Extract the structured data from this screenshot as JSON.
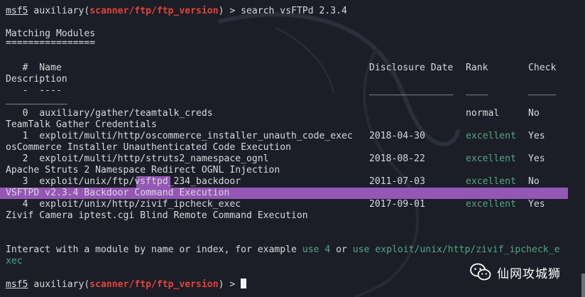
{
  "prompt": {
    "user": "msf5",
    "module_prefix": " auxiliary(",
    "module": "scanner/ftp/ftp_version",
    "module_suffix": ") > "
  },
  "command": "search vsFTPd 2.3.4",
  "heading": "Matching Modules",
  "heading_rule": "================",
  "columns": {
    "num": "   #  Name",
    "date": "Disclosure Date",
    "rank": "Rank",
    "check": "Check",
    "description": "Description"
  },
  "column_rules": {
    "num": "   -  ----",
    "date": "_______________",
    "rank": "____",
    "check": "_____",
    "description": "___________"
  },
  "modules": [
    {
      "index": "   0  ",
      "name": "auxiliary/gather/teamtalk_creds",
      "date": "",
      "rank": "normal",
      "check": "No",
      "description": "TeamTalk Gather Credentials"
    },
    {
      "index": "   1  ",
      "name": "exploit/multi/http/oscommerce_installer_unauth_code_exec",
      "date": "2018-04-30",
      "rank": "excellent",
      "check": "Yes",
      "description": "osCommerce Installer Unauthenticated Code Execution"
    },
    {
      "index": "   2  ",
      "name": "exploit/multi/http/struts2_namespace_ognl",
      "date": "2018-08-22",
      "rank": "excellent",
      "check": "Yes",
      "description": "Apache Struts 2 Namespace Redirect OGNL Injection"
    },
    {
      "index": "   3  ",
      "name_before": "exploit/unix/ftp/",
      "name_match": "vsftpd",
      "name_after": "_234_backdoor",
      "date": "2011-07-03",
      "rank": "excellent",
      "check": "No",
      "description": "VSFTPD v2.3.4 Backdoor Command Execution"
    },
    {
      "index": "   4  ",
      "name": "exploit/unix/http/zivif_ipcheck_exec",
      "date": "2017-09-01",
      "rank": "excellent",
      "check": "Yes",
      "description": "Zivif Camera iptest.cgi Blind Remote Command Execution"
    }
  ],
  "interact": {
    "text1": "Interact with a module by name or index, for example ",
    "cmd1": "use 4",
    "text2": " or ",
    "cmd2": "use exploit/unix/http/zivif_ipcheck_e",
    "cmd2_wrap": "xec"
  },
  "watermark": {
    "brand": "仙网攻城狮"
  },
  "colors": {
    "background": "#1b1e26",
    "text": "#d6d9de",
    "prompt_module": "#e2443a",
    "rank_excellent": "#4fa985",
    "highlight": "#9457b3"
  }
}
